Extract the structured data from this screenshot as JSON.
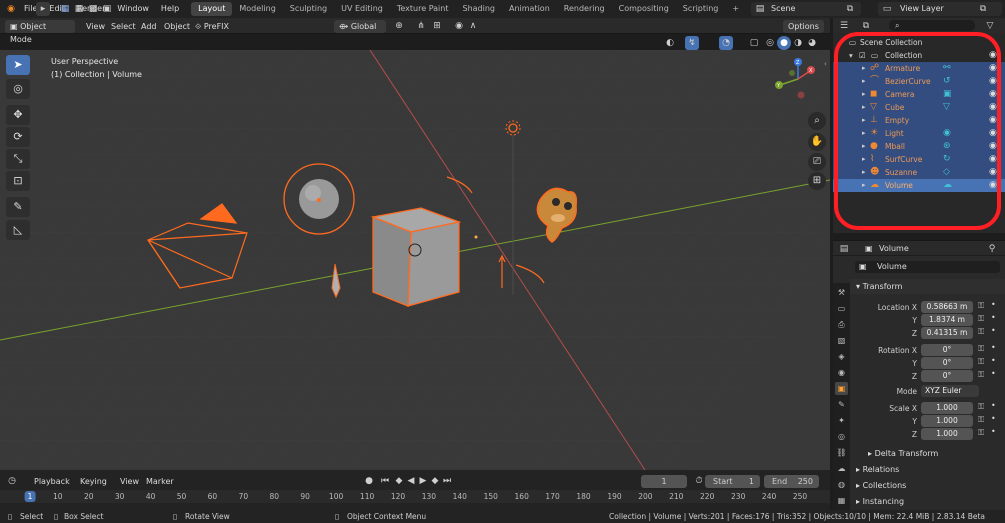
{
  "topbar": {
    "menus": [
      "File",
      "Edit",
      "Render",
      "Window",
      "Help"
    ],
    "workspaces": [
      "Layout",
      "Modeling",
      "Sculpting",
      "UV Editing",
      "Texture Paint",
      "Shading",
      "Animation",
      "Rendering",
      "Compositing",
      "Scripting"
    ],
    "active_workspace": "Layout",
    "add_tab": "+",
    "scene": "Scene",
    "view_layer": "View Layer"
  },
  "viewport_header": {
    "mode": "Object Mode",
    "menus": [
      "View",
      "Select",
      "Add",
      "Object"
    ],
    "addon": "PreFIX",
    "orientation": "Global",
    "options": "Options"
  },
  "viewport": {
    "perspective": "User Perspective",
    "collection_info": "(1) Collection | Volume",
    "gizmo_axes": {
      "x": "X",
      "y": "Y",
      "z": "Z"
    },
    "grid_color": "#404040",
    "x_axis_color": "#b34d4d",
    "y_axis_color": "#7aa32e",
    "selection_color": "#ff6a1f"
  },
  "outliner": {
    "root": "Scene Collection",
    "collection": "Collection",
    "items": [
      {
        "name": "Armature",
        "type_icon": "☍",
        "data_icon": "⚯"
      },
      {
        "name": "BezierCurve",
        "type_icon": "⌒",
        "data_icon": "↺"
      },
      {
        "name": "Camera",
        "type_icon": "◼",
        "data_icon": "▣"
      },
      {
        "name": "Cube",
        "type_icon": "▽",
        "data_icon": "▽"
      },
      {
        "name": "Empty",
        "type_icon": "⊥",
        "data_icon": ""
      },
      {
        "name": "Light",
        "type_icon": "☀",
        "data_icon": "◉"
      },
      {
        "name": "Mball",
        "type_icon": "●",
        "data_icon": "⊛"
      },
      {
        "name": "SurfCurve",
        "type_icon": "⌇",
        "data_icon": "↻"
      },
      {
        "name": "Suzanne",
        "type_icon": "☻",
        "data_icon": "◇"
      },
      {
        "name": "Volume",
        "type_icon": "☁",
        "data_icon": "☁"
      }
    ],
    "active_item": "Volume"
  },
  "properties": {
    "object_name": "Volume",
    "name_field": "Volume",
    "transform_header": "Transform",
    "location_label": "Location X",
    "rotation_label": "Rotation X",
    "scale_label": "Scale X",
    "axis_y": "Y",
    "axis_z": "Z",
    "location": [
      "0.58663 m",
      "1.8374 m",
      "0.41315 m"
    ],
    "rotation": [
      "0°",
      "0°",
      "0°"
    ],
    "mode_label": "Mode",
    "mode_value": "XYZ Euler",
    "scale": [
      "1.000",
      "1.000",
      "1.000"
    ],
    "panels": [
      "Delta Transform",
      "Relations",
      "Collections",
      "Instancing"
    ]
  },
  "timeline": {
    "menus": [
      "Playback",
      "Keying",
      "View",
      "Marker"
    ],
    "current_frame": "1",
    "start_label": "Start",
    "start": "1",
    "end_label": "End",
    "end": "250",
    "ruler": [
      "1",
      "10",
      "20",
      "30",
      "40",
      "50",
      "60",
      "70",
      "80",
      "90",
      "100",
      "110",
      "120",
      "130",
      "140",
      "150",
      "160",
      "170",
      "180",
      "190",
      "200",
      "210",
      "220",
      "230",
      "240",
      "250"
    ]
  },
  "statusbar": {
    "select": "Select",
    "box_select": "Box Select",
    "rotate_view": "Rotate View",
    "context_menu": "Object Context Menu",
    "stats": "Collection | Volume | Verts:201 | Faces:176 | Tris:352 | Objects:10/10 | Mem: 22.4 MiB | 2.83.14 Beta"
  },
  "annotation": {
    "color": "#ff1f24"
  }
}
